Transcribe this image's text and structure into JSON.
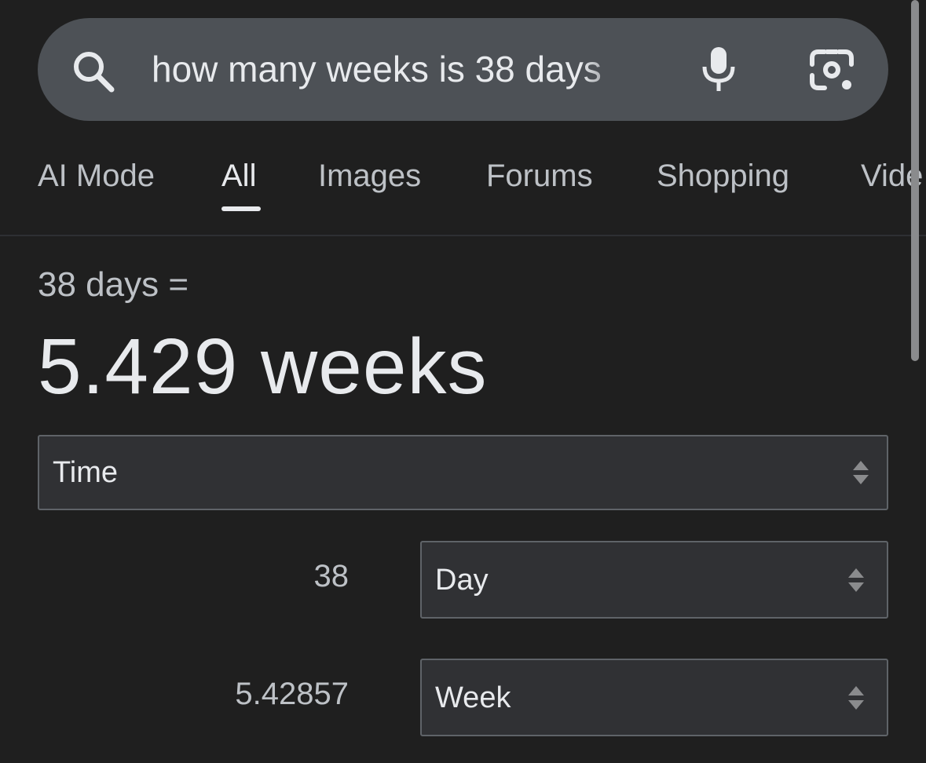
{
  "search": {
    "query": "how many weeks is 38 days",
    "icons": {
      "search": "search-icon",
      "voice": "microphone-icon",
      "lens": "lens-icon"
    }
  },
  "tabs": [
    {
      "label": "AI Mode",
      "active": false
    },
    {
      "label": "All",
      "active": true
    },
    {
      "label": "Images",
      "active": false
    },
    {
      "label": "Forums",
      "active": false
    },
    {
      "label": "Shopping",
      "active": false
    },
    {
      "label": "Vide",
      "active": false
    }
  ],
  "converter": {
    "equation": "38 days =",
    "result": "5.429 weeks",
    "category": "Time",
    "from": {
      "value": "38",
      "unit": "Day"
    },
    "to": {
      "value": "5.42857",
      "unit": "Week"
    }
  },
  "colors": {
    "background": "#1f1f1f",
    "search_bar": "#4d5156",
    "text_primary": "#e8eaed",
    "text_secondary": "#bdc1c6",
    "select_bg": "#303134",
    "select_border": "#5f6368"
  }
}
